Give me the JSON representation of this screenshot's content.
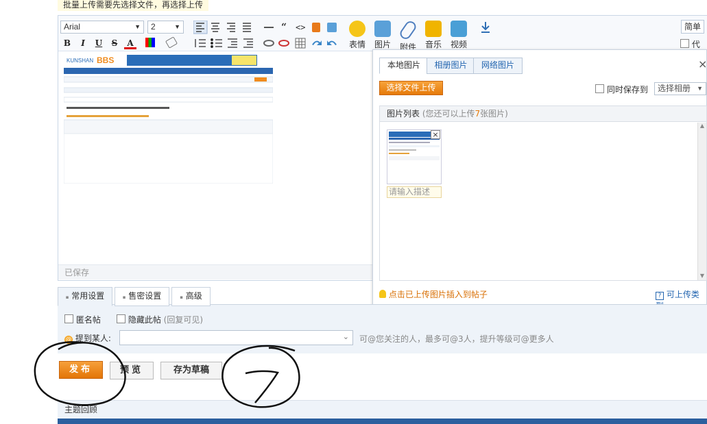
{
  "top_tip": "批量上传需要先选择文件，再选择上传",
  "toolbar": {
    "font_name": "Arial",
    "font_size": "2",
    "buttons": {
      "bold": "B",
      "italic": "I",
      "underline": "U",
      "strike": "S",
      "forecolor": "A"
    },
    "insert": [
      {
        "label": "表情",
        "icon": "smiley-icon",
        "color": "#f5c518"
      },
      {
        "label": "图片",
        "icon": "image-icon",
        "color": "#5aa0d8"
      },
      {
        "label": "附件",
        "icon": "paperclip-icon",
        "color": "#4f7fbf"
      },
      {
        "label": "音乐",
        "icon": "music-note-icon",
        "color": "#f0b400"
      },
      {
        "label": "视频",
        "icon": "video-icon",
        "color": "#4a9fd6"
      }
    ],
    "simple_label": "简单",
    "code_label": "代码"
  },
  "editor": {
    "saved_label": "已保存"
  },
  "image_panel": {
    "tabs": [
      "本地图片",
      "相册图片",
      "网络图片"
    ],
    "upload_button": "选择文件上传",
    "save_to_label": "同时保存到",
    "album_select": "选择相册",
    "list_title": "图片列表",
    "list_hint_prefix": "(您还可以上传",
    "list_hint_count": "7",
    "list_hint_suffix": "张图片)",
    "desc_placeholder": "请输入描述",
    "insert_hint": "点击已上传图片插入到帖子",
    "types_label": "可上传类型"
  },
  "settings": {
    "tabs": [
      "常用设置",
      "售密设置",
      "高级"
    ],
    "anonymous_label": "匿名帖",
    "hide_label": "隐藏此帖",
    "hide_note": "(回复可见)",
    "mention_label": "提到某人:",
    "mention_hint": "可@您关注的人，最多可@3人，提升等级可@更多人"
  },
  "actions": {
    "publish": "发布",
    "preview": "预览",
    "draft": "存为草稿"
  },
  "reply_section": {
    "title": "主题回顾"
  },
  "colors": {
    "accent_orange": "#e67a0a",
    "link_blue": "#2466b0",
    "panel_bg": "#eef3f9"
  }
}
